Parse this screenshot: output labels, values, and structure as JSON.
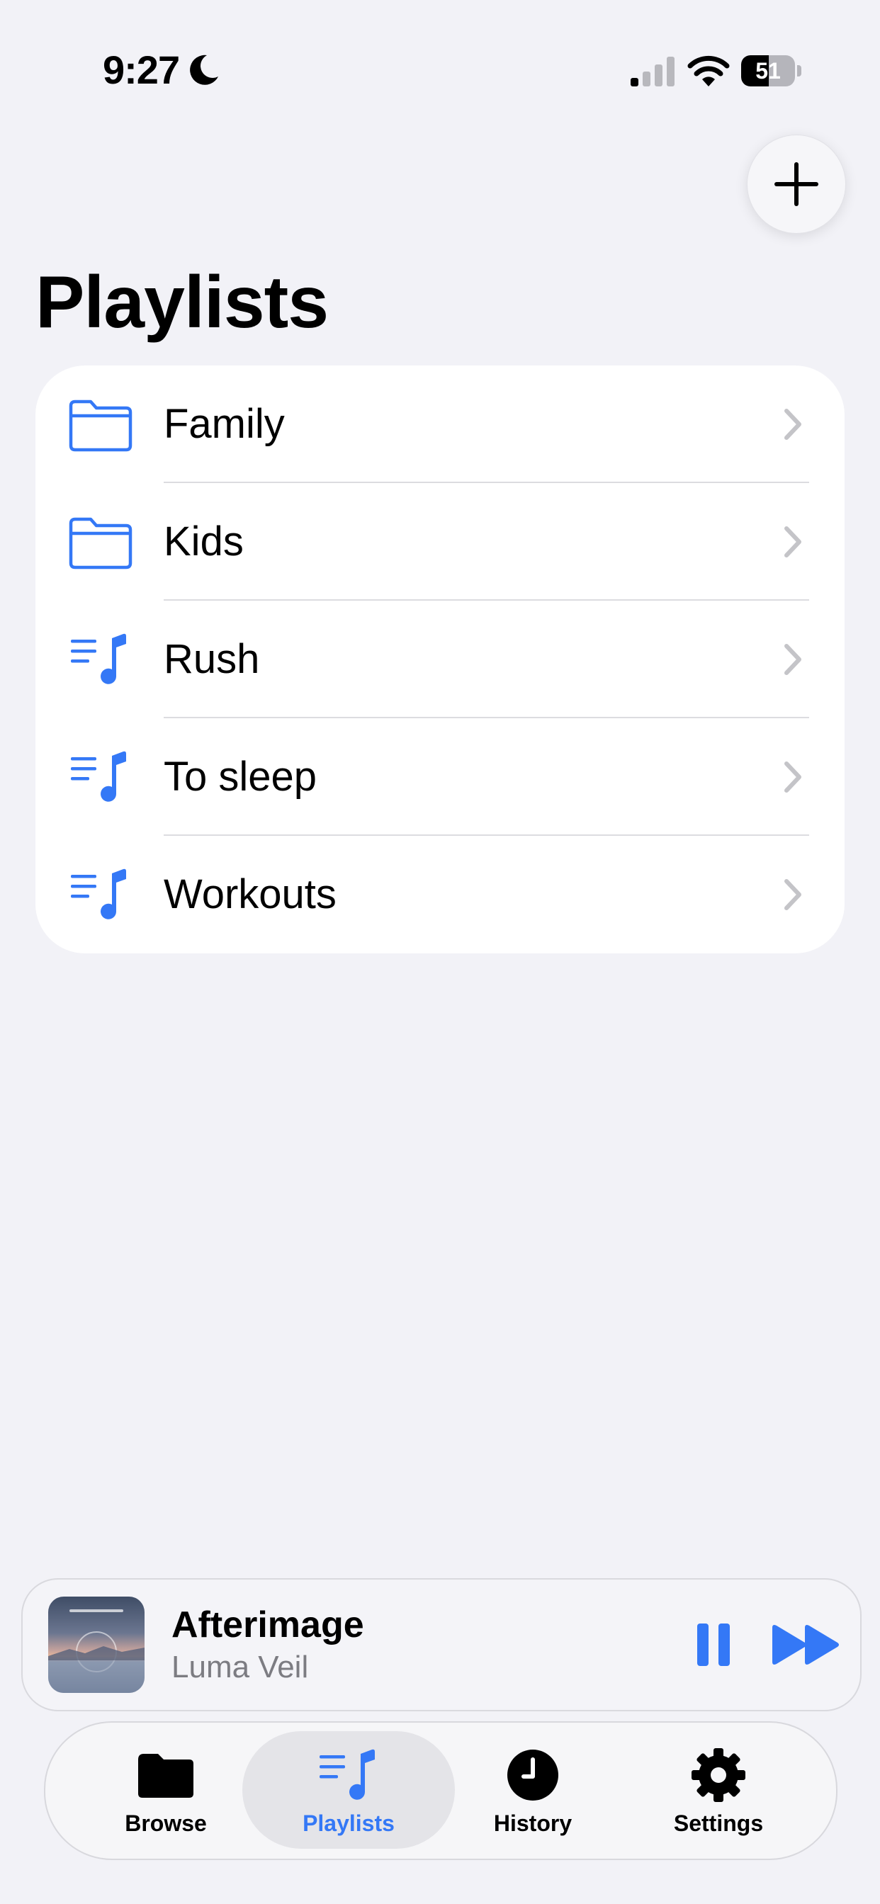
{
  "status_bar": {
    "time": "9:27",
    "battery": "51",
    "battery_level": 0.51
  },
  "header": {
    "title": "Playlists",
    "add_icon": "plus-icon"
  },
  "colors": {
    "accent": "#3478f6",
    "background": "#f2f2f7",
    "card": "#ffffff",
    "secondary_text": "#7c7c82"
  },
  "playlists": {
    "items": [
      {
        "label": "Family",
        "icon": "folder-icon"
      },
      {
        "label": "Kids",
        "icon": "folder-icon"
      },
      {
        "label": "Rush",
        "icon": "playlist-icon"
      },
      {
        "label": "To sleep",
        "icon": "playlist-icon"
      },
      {
        "label": "Workouts",
        "icon": "playlist-icon"
      }
    ]
  },
  "now_playing": {
    "title": "Afterimage",
    "artist": "Luma Veil"
  },
  "tab_bar": {
    "items": [
      {
        "label": "Browse",
        "icon": "folder-icon",
        "active": false
      },
      {
        "label": "Playlists",
        "icon": "playlist-icon",
        "active": true
      },
      {
        "label": "History",
        "icon": "clock-icon",
        "active": false
      },
      {
        "label": "Settings",
        "icon": "gear-icon",
        "active": false
      }
    ]
  }
}
